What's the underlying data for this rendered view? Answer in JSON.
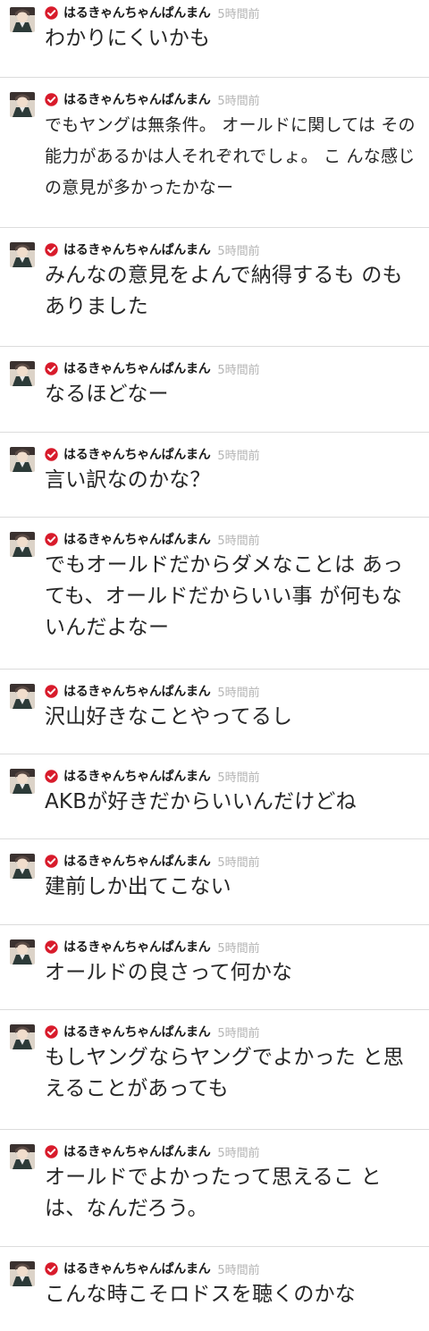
{
  "user": {
    "name": "はるきゃんちゃんぱんまん",
    "time": "5時間前"
  },
  "messages": [
    {
      "text": "わかりにくいかも"
    },
    {
      "text": "でもヤングは無条件。 オールドに関しては その能力があるかは人それぞれでしょ。 こ んな感じの意見が多かったかなー"
    },
    {
      "text": "みんなの意見をよんで納得するも のもありました"
    },
    {
      "text": "なるほどなー"
    },
    {
      "text": "言い訳なのかな？"
    },
    {
      "text": "でもオールドだからダメなことは あっても、オールドだからいい事 が何もないんだよなー"
    },
    {
      "text": "沢山好きなことやってるし"
    },
    {
      "text": "AKBが好きだからいいんだけどね"
    },
    {
      "text": "建前しか出てこない"
    },
    {
      "text": "オールドの良さって何かな"
    },
    {
      "text": "もしヤングならヤングでよかった と思えることがあっても"
    },
    {
      "text": "オールドでよかったって思えるこ とは、なんだろう。"
    },
    {
      "text": "こんな時こそロドスを聴くのかな"
    }
  ]
}
